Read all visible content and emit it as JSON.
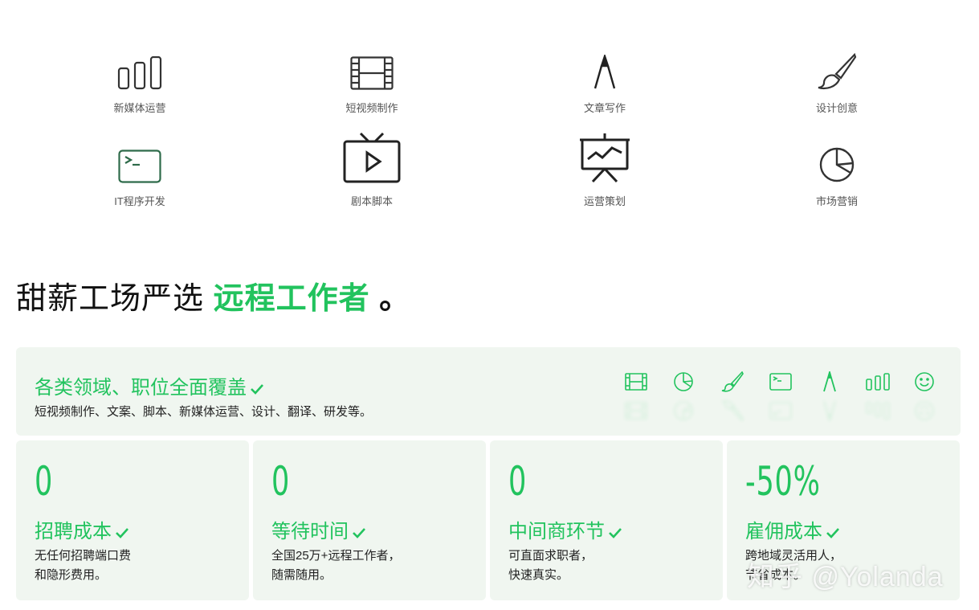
{
  "categories": [
    {
      "label": "新媒体运营",
      "icon": "bar-chart-icon"
    },
    {
      "label": "短视频制作",
      "icon": "film-icon"
    },
    {
      "label": "文章写作",
      "icon": "compass-pen-icon"
    },
    {
      "label": "设计创意",
      "icon": "paint-brush-icon"
    },
    {
      "label": "IT程序开发",
      "icon": "terminal-icon"
    },
    {
      "label": "剧本脚本",
      "icon": "tv-play-icon"
    },
    {
      "label": "运营策划",
      "icon": "presentation-board-icon"
    },
    {
      "label": "市场营销",
      "icon": "pie-chart-icon"
    }
  ],
  "headline": {
    "prefix": "甜薪工场严选 ",
    "highlight": "远程工作者",
    "suffix": " 。"
  },
  "coverage": {
    "title": "各类领域、职位全面覆盖",
    "subtitle": "短视频制作、文案、脚本、新媒体运营、设计、翻译、研发等。",
    "icons": [
      "film-icon",
      "pie-chart-icon",
      "paint-brush-icon",
      "terminal-icon",
      "compass-pen-icon",
      "bar-chart-icon",
      "smiley-icon"
    ]
  },
  "cards": [
    {
      "number": "0",
      "title": "招聘成本",
      "desc": "无任何招聘端口费\n和隐形费用。"
    },
    {
      "number": "0",
      "title": "等待时间",
      "desc": "全国25万+远程工作者，\n随需随用。"
    },
    {
      "number": "0",
      "title": "中间商环节",
      "desc": "可直面求职者，\n快速真实。"
    },
    {
      "number": "-50%",
      "title": "雇佣成本",
      "desc": "跨地域灵活用人，\n节省成本。"
    }
  ],
  "watermark": "知乎 @Yolanda",
  "colors": {
    "accent": "#22c35e",
    "panel": "#f0f6f0",
    "icon_dark": "#333333",
    "icon_green": "#2e8b57"
  }
}
